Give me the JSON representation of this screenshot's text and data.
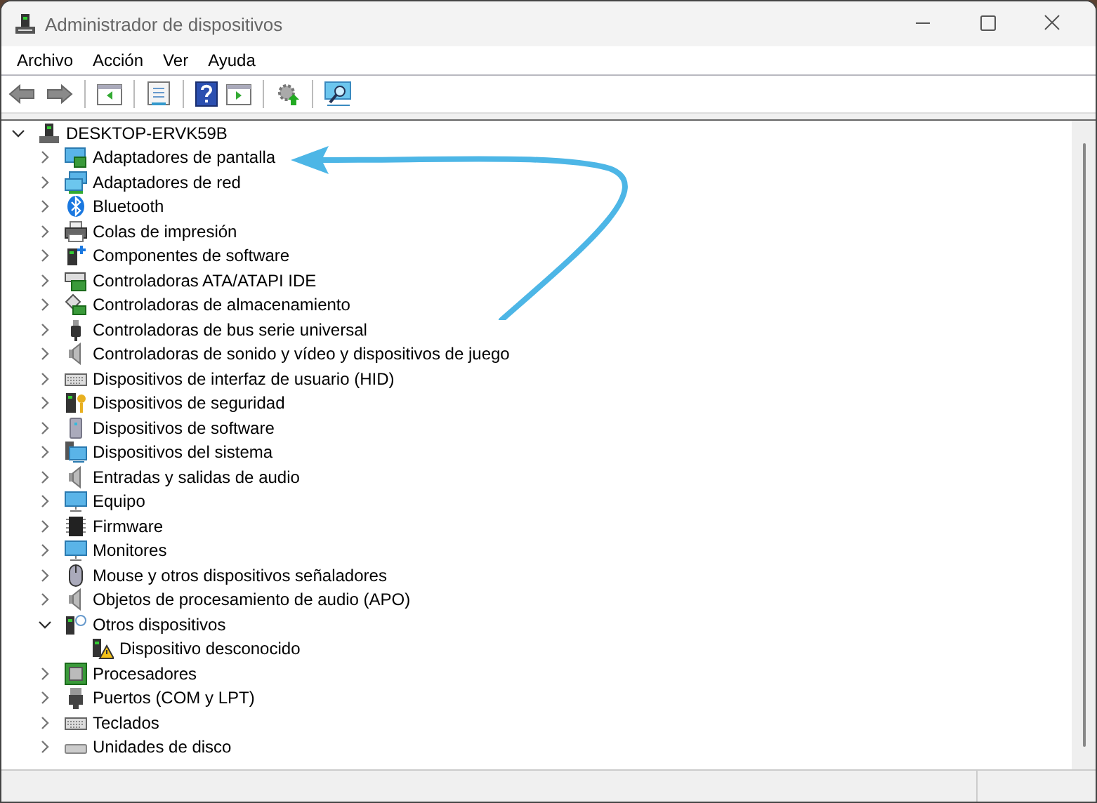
{
  "window": {
    "title": "Administrador de dispositivos"
  },
  "menu": [
    {
      "label": "Archivo"
    },
    {
      "label": "Acción"
    },
    {
      "label": "Ver"
    },
    {
      "label": "Ayuda"
    }
  ],
  "tree": [
    {
      "label": "DESKTOP-ERVK59B",
      "expanded": true,
      "children": [
        {
          "label": "Adaptadores de pantalla",
          "expanded": false
        },
        {
          "label": "Adaptadores de red",
          "expanded": false
        },
        {
          "label": "Bluetooth",
          "expanded": false
        },
        {
          "label": "Colas de impresión",
          "expanded": false
        },
        {
          "label": "Componentes de software",
          "expanded": false
        },
        {
          "label": "Controladoras ATA/ATAPI IDE",
          "expanded": false
        },
        {
          "label": "Controladoras de almacenamiento",
          "expanded": false
        },
        {
          "label": "Controladoras de bus serie universal",
          "expanded": false
        },
        {
          "label": "Controladoras de sonido y vídeo y dispositivos de juego",
          "expanded": false
        },
        {
          "label": "Dispositivos de interfaz de usuario (HID)",
          "expanded": false
        },
        {
          "label": "Dispositivos de seguridad",
          "expanded": false
        },
        {
          "label": "Dispositivos de software",
          "expanded": false
        },
        {
          "label": "Dispositivos del sistema",
          "expanded": false
        },
        {
          "label": "Entradas y salidas de audio",
          "expanded": false
        },
        {
          "label": "Equipo",
          "expanded": false
        },
        {
          "label": "Firmware",
          "expanded": false
        },
        {
          "label": "Monitores",
          "expanded": false
        },
        {
          "label": "Mouse y otros dispositivos señaladores",
          "expanded": false
        },
        {
          "label": "Objetos de procesamiento de audio (APO)",
          "expanded": false
        },
        {
          "label": "Otros dispositivos",
          "expanded": true,
          "children": [
            {
              "label": "Dispositivo desconocido"
            }
          ]
        },
        {
          "label": "Procesadores",
          "expanded": false
        },
        {
          "label": "Puertos (COM y LPT)",
          "expanded": false
        },
        {
          "label": "Teclados",
          "expanded": false
        },
        {
          "label": "Unidades de disco",
          "expanded": false
        }
      ]
    }
  ]
}
